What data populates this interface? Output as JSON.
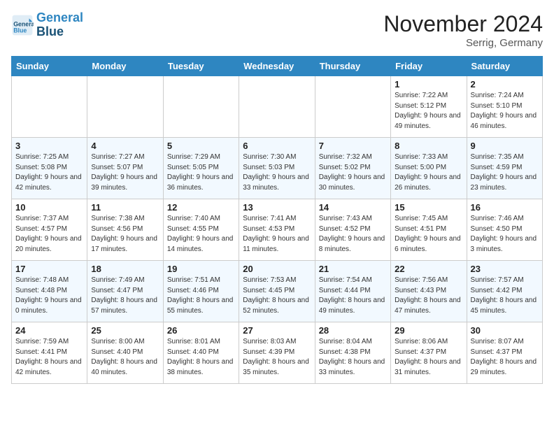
{
  "header": {
    "logo_line1": "General",
    "logo_line2": "Blue",
    "month_title": "November 2024",
    "location": "Serrig, Germany"
  },
  "weekdays": [
    "Sunday",
    "Monday",
    "Tuesday",
    "Wednesday",
    "Thursday",
    "Friday",
    "Saturday"
  ],
  "weeks": [
    [
      {
        "day": "",
        "info": ""
      },
      {
        "day": "",
        "info": ""
      },
      {
        "day": "",
        "info": ""
      },
      {
        "day": "",
        "info": ""
      },
      {
        "day": "",
        "info": ""
      },
      {
        "day": "1",
        "info": "Sunrise: 7:22 AM\nSunset: 5:12 PM\nDaylight: 9 hours and 49 minutes."
      },
      {
        "day": "2",
        "info": "Sunrise: 7:24 AM\nSunset: 5:10 PM\nDaylight: 9 hours and 46 minutes."
      }
    ],
    [
      {
        "day": "3",
        "info": "Sunrise: 7:25 AM\nSunset: 5:08 PM\nDaylight: 9 hours and 42 minutes."
      },
      {
        "day": "4",
        "info": "Sunrise: 7:27 AM\nSunset: 5:07 PM\nDaylight: 9 hours and 39 minutes."
      },
      {
        "day": "5",
        "info": "Sunrise: 7:29 AM\nSunset: 5:05 PM\nDaylight: 9 hours and 36 minutes."
      },
      {
        "day": "6",
        "info": "Sunrise: 7:30 AM\nSunset: 5:03 PM\nDaylight: 9 hours and 33 minutes."
      },
      {
        "day": "7",
        "info": "Sunrise: 7:32 AM\nSunset: 5:02 PM\nDaylight: 9 hours and 30 minutes."
      },
      {
        "day": "8",
        "info": "Sunrise: 7:33 AM\nSunset: 5:00 PM\nDaylight: 9 hours and 26 minutes."
      },
      {
        "day": "9",
        "info": "Sunrise: 7:35 AM\nSunset: 4:59 PM\nDaylight: 9 hours and 23 minutes."
      }
    ],
    [
      {
        "day": "10",
        "info": "Sunrise: 7:37 AM\nSunset: 4:57 PM\nDaylight: 9 hours and 20 minutes."
      },
      {
        "day": "11",
        "info": "Sunrise: 7:38 AM\nSunset: 4:56 PM\nDaylight: 9 hours and 17 minutes."
      },
      {
        "day": "12",
        "info": "Sunrise: 7:40 AM\nSunset: 4:55 PM\nDaylight: 9 hours and 14 minutes."
      },
      {
        "day": "13",
        "info": "Sunrise: 7:41 AM\nSunset: 4:53 PM\nDaylight: 9 hours and 11 minutes."
      },
      {
        "day": "14",
        "info": "Sunrise: 7:43 AM\nSunset: 4:52 PM\nDaylight: 9 hours and 8 minutes."
      },
      {
        "day": "15",
        "info": "Sunrise: 7:45 AM\nSunset: 4:51 PM\nDaylight: 9 hours and 6 minutes."
      },
      {
        "day": "16",
        "info": "Sunrise: 7:46 AM\nSunset: 4:50 PM\nDaylight: 9 hours and 3 minutes."
      }
    ],
    [
      {
        "day": "17",
        "info": "Sunrise: 7:48 AM\nSunset: 4:48 PM\nDaylight: 9 hours and 0 minutes."
      },
      {
        "day": "18",
        "info": "Sunrise: 7:49 AM\nSunset: 4:47 PM\nDaylight: 8 hours and 57 minutes."
      },
      {
        "day": "19",
        "info": "Sunrise: 7:51 AM\nSunset: 4:46 PM\nDaylight: 8 hours and 55 minutes."
      },
      {
        "day": "20",
        "info": "Sunrise: 7:53 AM\nSunset: 4:45 PM\nDaylight: 8 hours and 52 minutes."
      },
      {
        "day": "21",
        "info": "Sunrise: 7:54 AM\nSunset: 4:44 PM\nDaylight: 8 hours and 49 minutes."
      },
      {
        "day": "22",
        "info": "Sunrise: 7:56 AM\nSunset: 4:43 PM\nDaylight: 8 hours and 47 minutes."
      },
      {
        "day": "23",
        "info": "Sunrise: 7:57 AM\nSunset: 4:42 PM\nDaylight: 8 hours and 45 minutes."
      }
    ],
    [
      {
        "day": "24",
        "info": "Sunrise: 7:59 AM\nSunset: 4:41 PM\nDaylight: 8 hours and 42 minutes."
      },
      {
        "day": "25",
        "info": "Sunrise: 8:00 AM\nSunset: 4:40 PM\nDaylight: 8 hours and 40 minutes."
      },
      {
        "day": "26",
        "info": "Sunrise: 8:01 AM\nSunset: 4:40 PM\nDaylight: 8 hours and 38 minutes."
      },
      {
        "day": "27",
        "info": "Sunrise: 8:03 AM\nSunset: 4:39 PM\nDaylight: 8 hours and 35 minutes."
      },
      {
        "day": "28",
        "info": "Sunrise: 8:04 AM\nSunset: 4:38 PM\nDaylight: 8 hours and 33 minutes."
      },
      {
        "day": "29",
        "info": "Sunrise: 8:06 AM\nSunset: 4:37 PM\nDaylight: 8 hours and 31 minutes."
      },
      {
        "day": "30",
        "info": "Sunrise: 8:07 AM\nSunset: 4:37 PM\nDaylight: 8 hours and 29 minutes."
      }
    ]
  ]
}
